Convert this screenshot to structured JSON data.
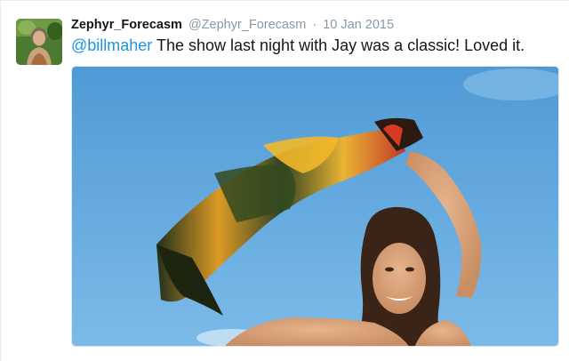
{
  "tweet": {
    "display_name": "Zephyr_Forecasm",
    "handle": "@Zephyr_Forecasm",
    "separator": "·",
    "timestamp": "10 Jan 2015",
    "mention": "@billmaher",
    "text": " The show last night with Jay was a classic! Loved it."
  },
  "colors": {
    "link": "#1b95e0",
    "name": "#14171a",
    "meta": "#8899a6",
    "sky": "#5ea9e0"
  }
}
